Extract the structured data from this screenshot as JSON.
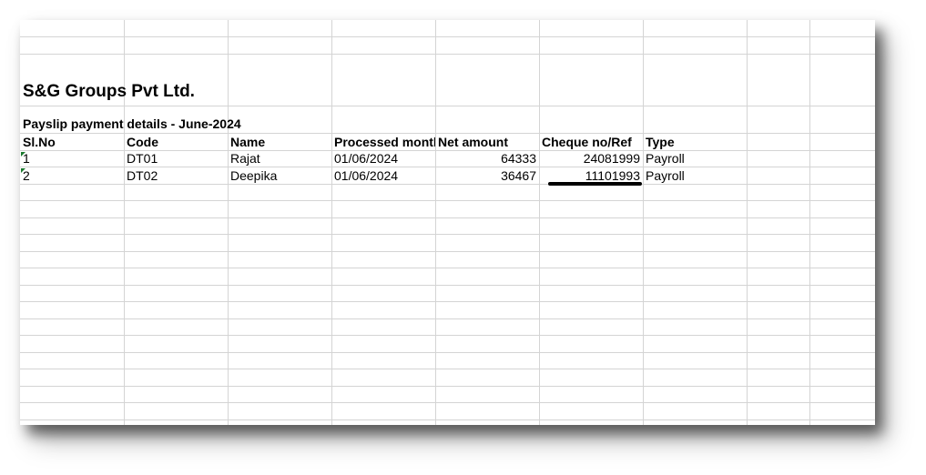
{
  "sheet": {
    "company": "S&G Groups Pvt  Ltd.",
    "subtitle": "Payslip payment details - June-2024",
    "headers": [
      "Sl.No",
      "Code",
      "Name",
      "Processed month",
      "Net amount",
      "Cheque no/Ref",
      "Type"
    ],
    "rows": [
      [
        "1",
        "DT01",
        "Rajat",
        "01/06/2024",
        "64333",
        "24081999",
        "Payroll"
      ],
      [
        "2",
        "DT02",
        "Deepika",
        "01/06/2024",
        "36467",
        "11101993",
        "Payroll"
      ]
    ],
    "colors": {
      "grid": "#d4d4d4",
      "marker": "#1a7a2e",
      "annotation": "#000000"
    }
  }
}
